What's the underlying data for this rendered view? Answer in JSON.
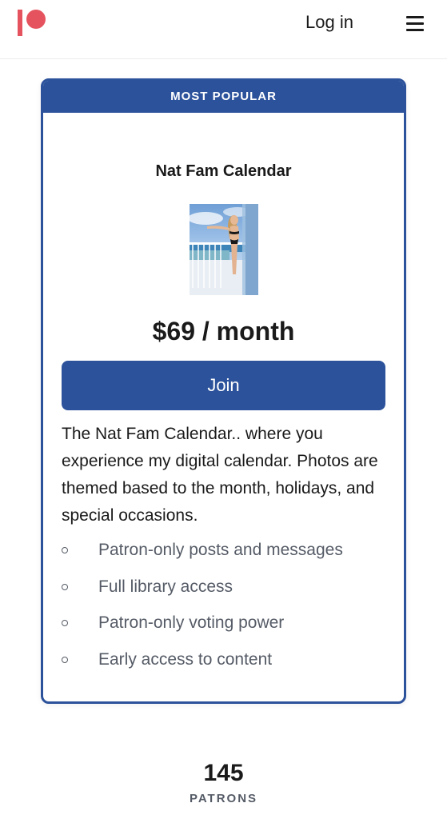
{
  "header": {
    "login_label": "Log in",
    "menu_icon": "hamburger-menu-icon",
    "logo_icon": "patreon-logo-icon",
    "brand_color": "#e5535e"
  },
  "tier": {
    "badge": "MOST POPULAR",
    "title": "Nat Fam Calendar",
    "price": "$69 / month",
    "join_label": "Join",
    "description": "The Nat Fam Calendar.. where you experience my digital calendar. Photos are themed based to the month, holidays, and special occasions.",
    "benefits": [
      "Patron-only posts and messages",
      "Full library access",
      "Patron-only voting power",
      "Early access to content"
    ],
    "accent_color": "#2c529b"
  },
  "stats": {
    "patrons_count": "145",
    "patrons_label": "PATRONS"
  }
}
